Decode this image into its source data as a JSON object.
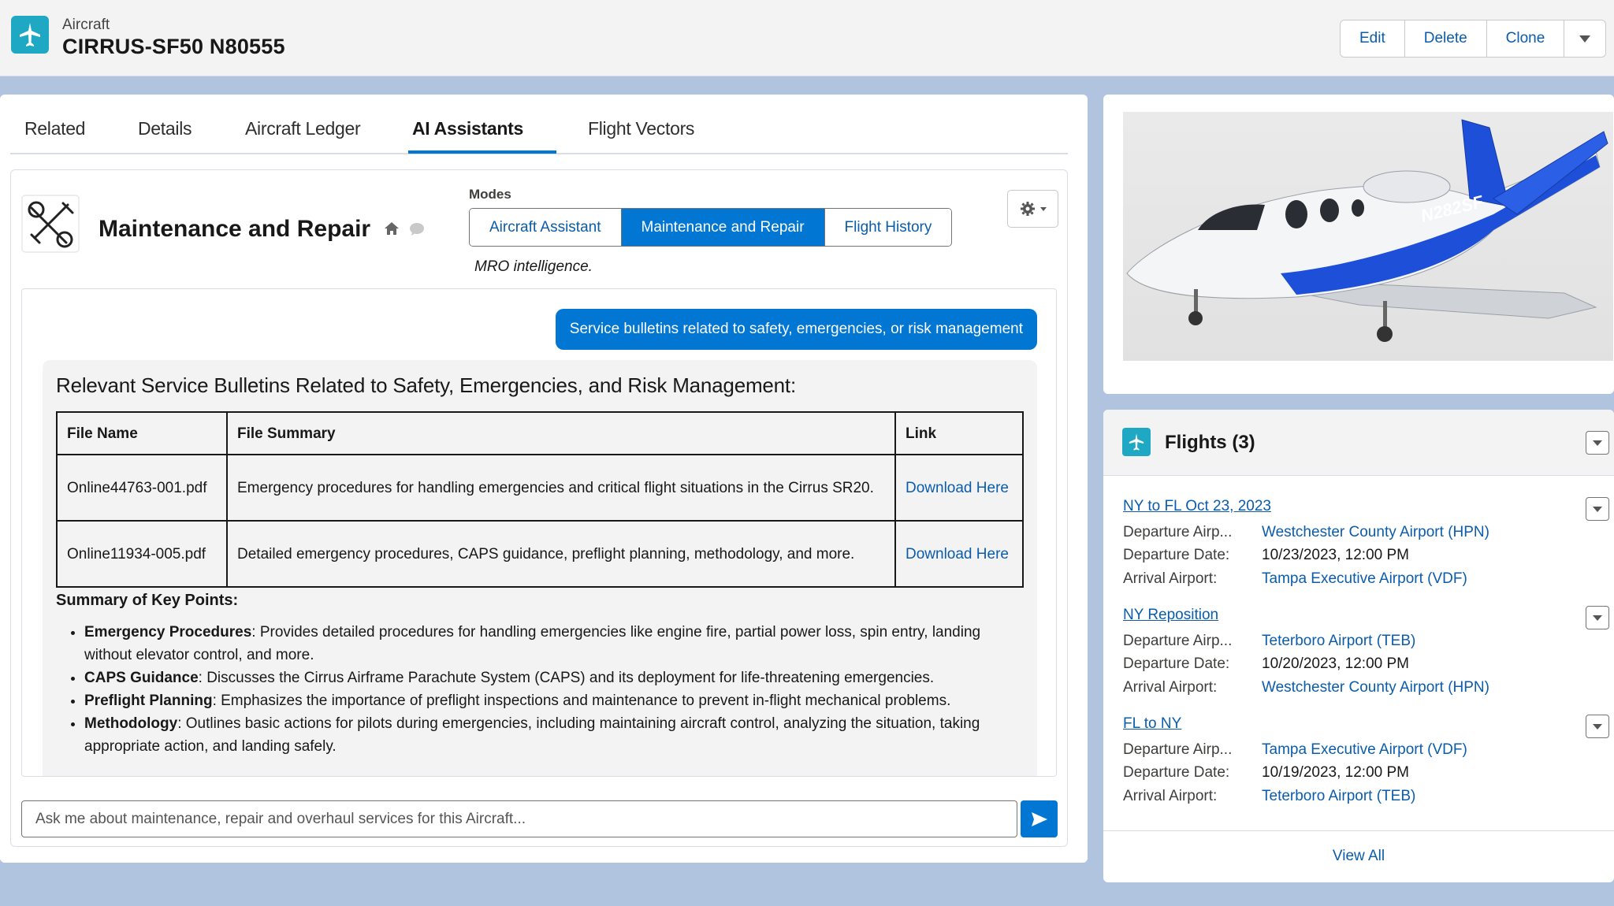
{
  "header": {
    "object_type": "Aircraft",
    "record_name": "CIRRUS-SF50 N80555",
    "actions": [
      "Edit",
      "Delete",
      "Clone"
    ],
    "icon": "airplane-icon",
    "brand_color": "#1fa8c4"
  },
  "tabs": [
    {
      "label": "Related",
      "active": false
    },
    {
      "label": "Details",
      "active": false
    },
    {
      "label": "Aircraft Ledger",
      "active": false
    },
    {
      "label": "AI Assistants",
      "active": true
    },
    {
      "label": "Flight Vectors",
      "active": false
    }
  ],
  "assistant": {
    "title": "Maintenance and Repair",
    "modes_label": "Modes",
    "modes": [
      {
        "label": "Aircraft Assistant",
        "active": false
      },
      {
        "label": "Maintenance and Repair",
        "active": true
      },
      {
        "label": "Flight History",
        "active": false
      }
    ],
    "mode_description": "MRO intelligence.",
    "user_message": "Service bulletins related to safety, emergencies, or risk management",
    "response": {
      "heading": "Relevant Service Bulletins Related to Safety, Emergencies, and Risk Management:",
      "table_headers": [
        "File Name",
        "File Summary",
        "Link"
      ],
      "rows": [
        {
          "file": "Online44763-001.pdf",
          "summary": "Emergency procedures for handling emergencies and critical flight situations in the Cirrus SR20.",
          "link": "Download Here"
        },
        {
          "file": "Online11934-005.pdf",
          "summary": "Detailed emergency procedures, CAPS guidance, preflight planning, methodology, and more.",
          "link": "Download Here"
        }
      ],
      "summary_title": "Summary of Key Points:",
      "points": [
        {
          "term": "Emergency Procedures",
          "text": ": Provides detailed procedures for handling emergencies like engine fire, partial power loss, spin entry, landing without elevator control, and more."
        },
        {
          "term": "CAPS Guidance",
          "text": ": Discusses the Cirrus Airframe Parachute System (CAPS) and its deployment for life-threatening emergencies."
        },
        {
          "term": "Preflight Planning",
          "text": ": Emphasizes the importance of preflight inspections and maintenance to prevent in-flight mechanical problems."
        },
        {
          "term": "Methodology",
          "text": ": Outlines basic actions for pilots during emergencies, including maintaining aircraft control, analyzing the situation, taking appropriate action, and landing safely."
        }
      ]
    },
    "input_placeholder": "Ask me about maintenance, repair and overhaul services for this Aircraft..."
  },
  "aircraft_image": {
    "tail_number": "N282SF"
  },
  "flights": {
    "title": "Flights (3)",
    "items": [
      {
        "name": "NY to FL Oct 23, 2023",
        "departure_airport_label": "Departure Airp...",
        "departure_airport": "Westchester County Airport (HPN)",
        "departure_date_label": "Departure Date:",
        "departure_date": "10/23/2023, 12:00 PM",
        "arrival_airport_label": "Arrival Airport:",
        "arrival_airport": "Tampa Executive Airport (VDF)"
      },
      {
        "name": "NY Reposition",
        "departure_airport_label": "Departure Airp...",
        "departure_airport": "Teterboro Airport (TEB)",
        "departure_date_label": "Departure Date:",
        "departure_date": "10/20/2023, 12:00 PM",
        "arrival_airport_label": "Arrival Airport:",
        "arrival_airport": "Westchester County Airport (HPN)"
      },
      {
        "name": "FL to NY",
        "departure_airport_label": "Departure Airp...",
        "departure_airport": "Tampa Executive Airport (VDF)",
        "departure_date_label": "Departure Date:",
        "departure_date": "10/19/2023, 12:00 PM",
        "arrival_airport_label": "Arrival Airport:",
        "arrival_airport": "Teterboro Airport (TEB)"
      }
    ],
    "view_all": "View All"
  }
}
